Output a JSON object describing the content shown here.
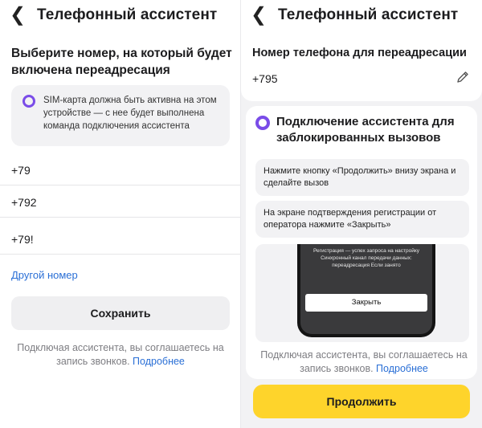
{
  "left": {
    "header_title": "Телефонный ассистент",
    "heading": "Выберите номер, на который будет включена переадресация",
    "info": "SIM-карта должна быть активна на этом устройстве — с нее будет выполнена команда подключения ассистента",
    "numbers": [
      "+79",
      "+792",
      "+79!"
    ],
    "other_number": "Другой номер",
    "save": "Сохранить",
    "consent_text": "Подключая ассистента, вы соглашаетесь на запись звонков.",
    "consent_link": "Подробнее"
  },
  "right": {
    "header_title": "Телефонный ассистент",
    "label": "Номер телефона для переадресации",
    "value": "+795",
    "card_title": "Подключение ассистента для заблокированных вызовов",
    "step1": "Нажмите кнопку «Продолжить» внизу экрана и сделайте вызов",
    "step2": "На экране подтверждения регистрации от оператора нажмите «Закрыть»",
    "phone_text": "Регистрация — успех запроса на настройку Синхронный канал передачи данных: переадресация Если занято",
    "phone_button": "Закрыть",
    "consent_text": "Подключая ассистента, вы соглашаетесь на запись звонков.",
    "consent_link": "Подробнее",
    "continue": "Продолжить"
  },
  "icons": {
    "back": "chevron-left-icon",
    "assistant": "alice-ring-icon",
    "edit": "pencil-icon"
  },
  "colors": {
    "accent_yellow": "#fed42b",
    "link_blue": "#2a6fd6",
    "alice_purple": "#7a4ce8"
  }
}
